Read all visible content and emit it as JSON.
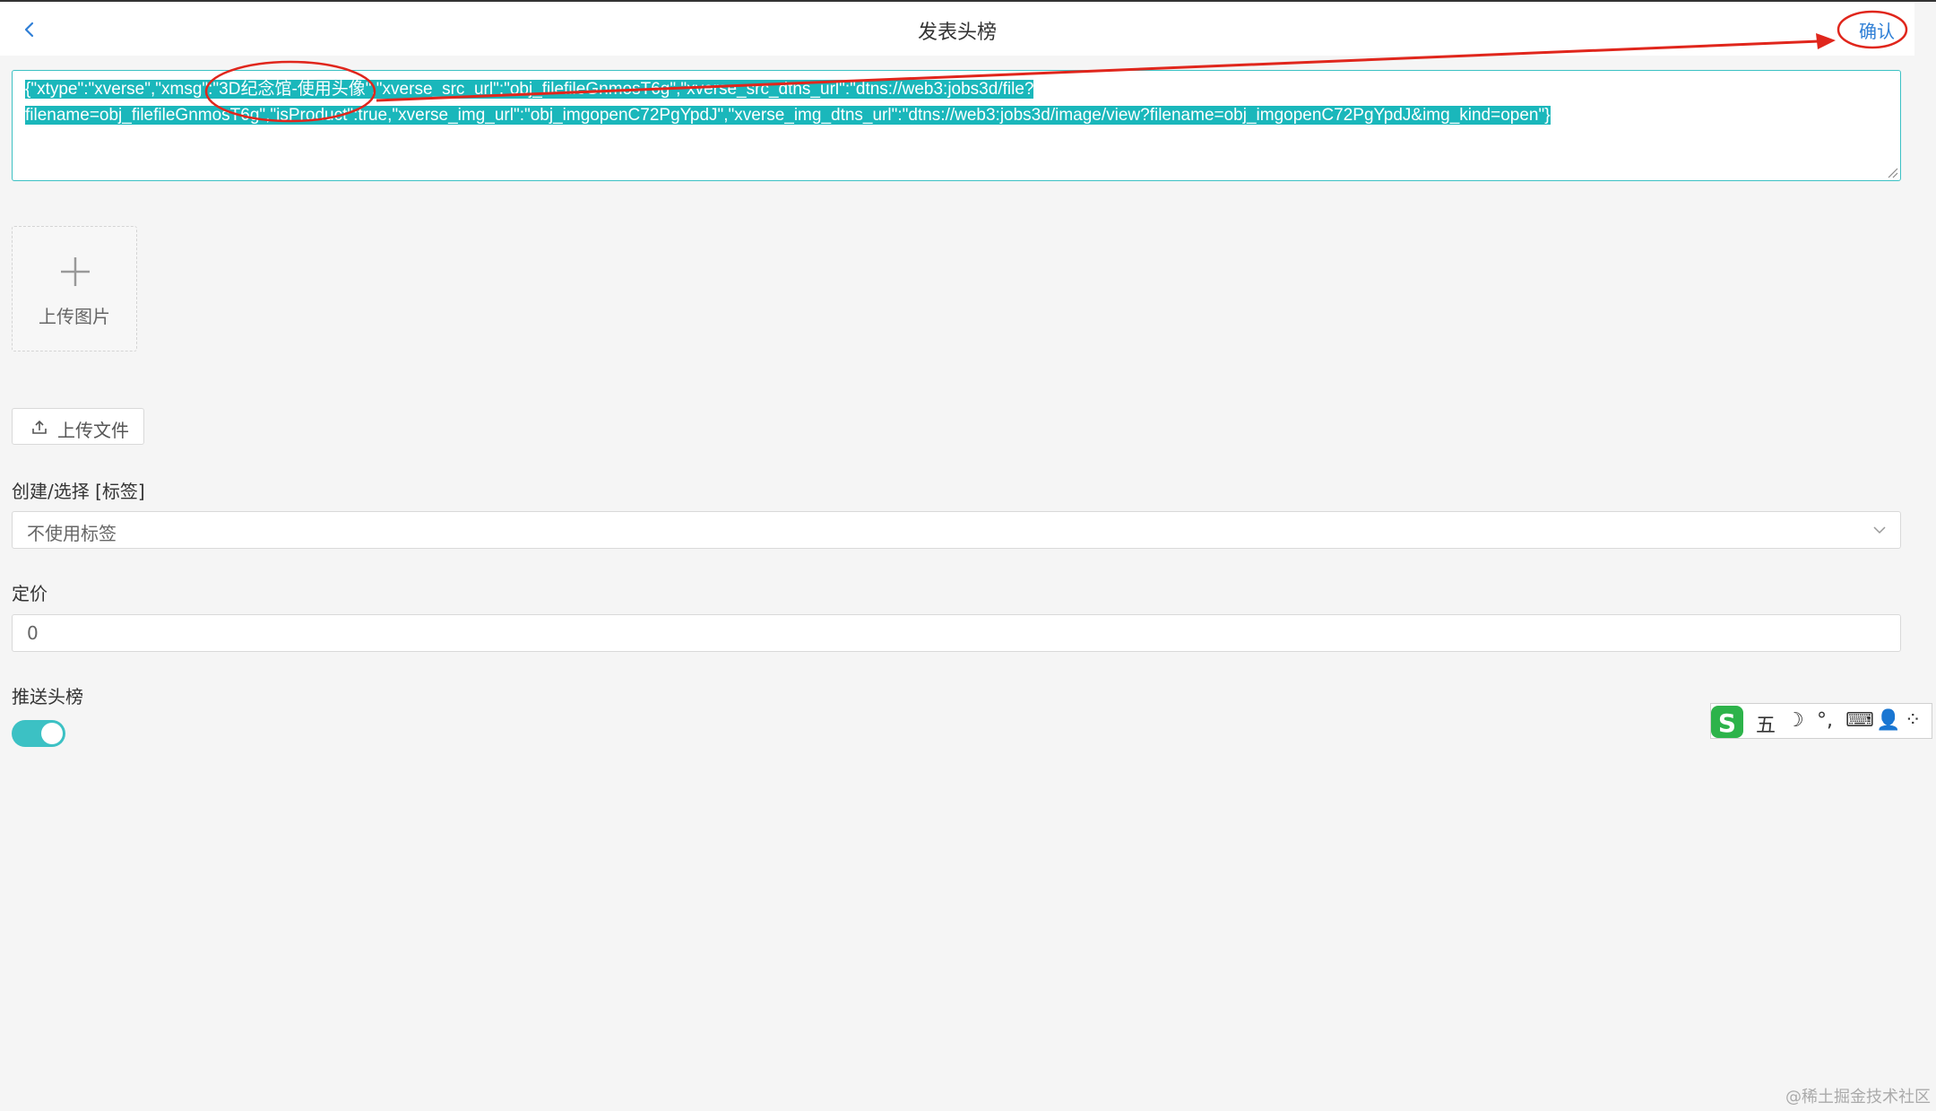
{
  "header": {
    "title": "发表头榜",
    "confirm_label": "确认"
  },
  "editor": {
    "line1": "{\"xtype\":\"xverse\",\"xmsg\":\"3D纪念馆-使用头像\",\"xverse_src_url\":\"obj_filefileGnmosT6g\",\"xverse_src_dtns_url\":\"dtns://web3:jobs3d/file?",
    "line2": "filename=obj_filefileGnmosT6g\",\"isProduct\":true,\"xverse_img_url\":\"obj_imgopenC72PgYpdJ\",\"xverse_img_dtns_url\":\"dtns://web3:jobs3d/image/view?filename=obj_imgopenC72PgYpdJ&img_kind=open\"}"
  },
  "upload_image": {
    "label": "上传图片"
  },
  "upload_file": {
    "label": "上传文件"
  },
  "tag": {
    "label": "创建/选择 [标签]",
    "selected": "不使用标签"
  },
  "price": {
    "label": "定价",
    "value": "0"
  },
  "push": {
    "label": "推送头榜",
    "enabled": true
  },
  "ime": {
    "items": [
      "五",
      "☽",
      "°,",
      "⌨",
      "👤",
      "⁘"
    ]
  },
  "watermark": "@稀土掘金技术社区",
  "colors": {
    "accent": "#3cc1c4",
    "link": "#2f7fd6",
    "annotation": "#e0261c"
  }
}
